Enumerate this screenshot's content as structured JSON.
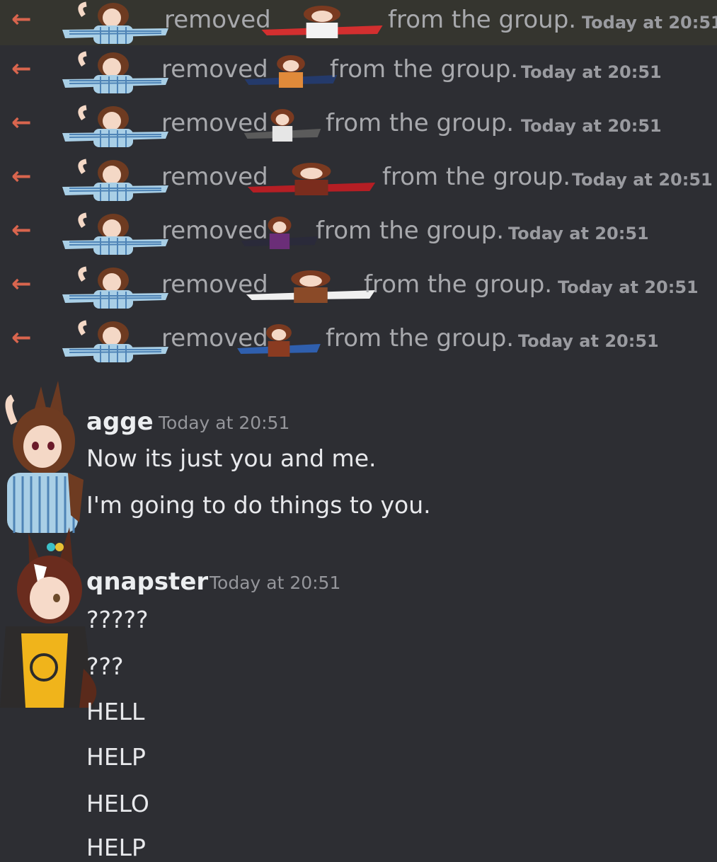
{
  "system_messages": [
    {
      "arrow": "←",
      "text_after": "from the group.",
      "timestamp": "Today at 20:51",
      "text_before": "removed",
      "highlighted": true
    },
    {
      "arrow": "←",
      "text_after": "from the group.",
      "timestamp": "Today at 20:51",
      "text_before": "removed",
      "highlighted": false
    },
    {
      "arrow": "←",
      "text_after": "from the group.",
      "timestamp": "Today at 20:51",
      "text_before": "removed",
      "highlighted": false
    },
    {
      "arrow": "←",
      "text_after": "from the group.",
      "timestamp": "Today at 20:51",
      "text_before": "removed",
      "highlighted": false
    },
    {
      "arrow": "←",
      "text_after": "from the group.",
      "timestamp": "Today at 20:51",
      "text_before": "removed",
      "highlighted": false
    },
    {
      "arrow": "←",
      "text_after": "from the group.",
      "timestamp": "Today at 20:51",
      "text_before": "removed",
      "highlighted": false
    },
    {
      "arrow": "←",
      "text_after": "from the group.",
      "timestamp": "Today at 20:51",
      "text_before": "removed",
      "highlighted": false
    }
  ],
  "messages": [
    {
      "author": "agge",
      "timestamp": "Today at 20:51",
      "lines": [
        "Now its just you and me.",
        "I'm going to do things to you."
      ]
    },
    {
      "author": "qnapster",
      "timestamp": "Today at 20:51",
      "lines": [
        "?????",
        "???",
        "HELL",
        "HELP",
        "HELO",
        "HELP"
      ]
    }
  ],
  "colors": {
    "background": "#2d2e33",
    "highlight_row": "#35352f",
    "leave_arrow": "#d9654e"
  }
}
